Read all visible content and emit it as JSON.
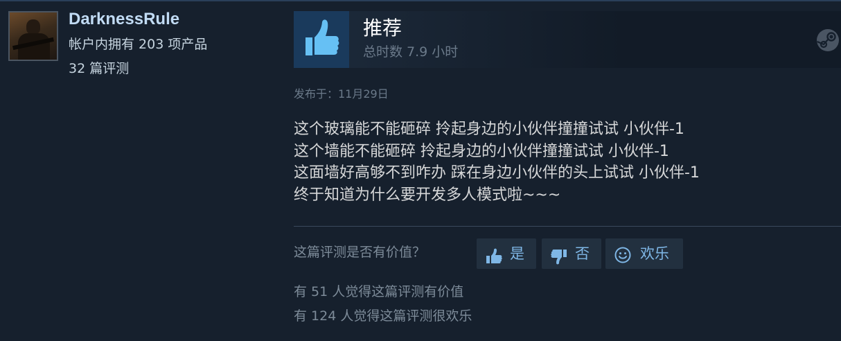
{
  "author": {
    "name": "DarknessRule",
    "products": "帐户内拥有 203 项产品",
    "reviews": "32 篇评测"
  },
  "review": {
    "verdict": "推荐",
    "hours": "总时数 7.9 小时",
    "posted": "发布于：11月29日",
    "lines": [
      "这个玻璃能不能砸碎 拎起身边的小伙伴撞撞试试 小伙伴-1",
      "这个墙能不能砸碎 拎起身边的小伙伴撞撞试试 小伙伴-1",
      "这面墙好高够不到咋办 踩在身边小伙伴的头上试试 小伙伴-1",
      "终于知道为什么要开发多人模式啦~~~"
    ]
  },
  "feedback": {
    "question": "这篇评测是否有价值？",
    "yes_label": "是",
    "no_label": "否",
    "funny_label": "欢乐",
    "helpful_count": "有 51 人觉得这篇评测有价值",
    "funny_count": "有 124 人觉得这篇评测很欢乐"
  },
  "icons": {
    "verdict": "thumbs-up-icon",
    "platform": "steam-icon",
    "yes": "thumbs-up-icon",
    "no": "thumbs-down-icon",
    "funny": "smiley-icon"
  },
  "colors": {
    "accent_blue": "#66c0f4",
    "author_name": "#c1dbf4",
    "background": "#16202d"
  }
}
